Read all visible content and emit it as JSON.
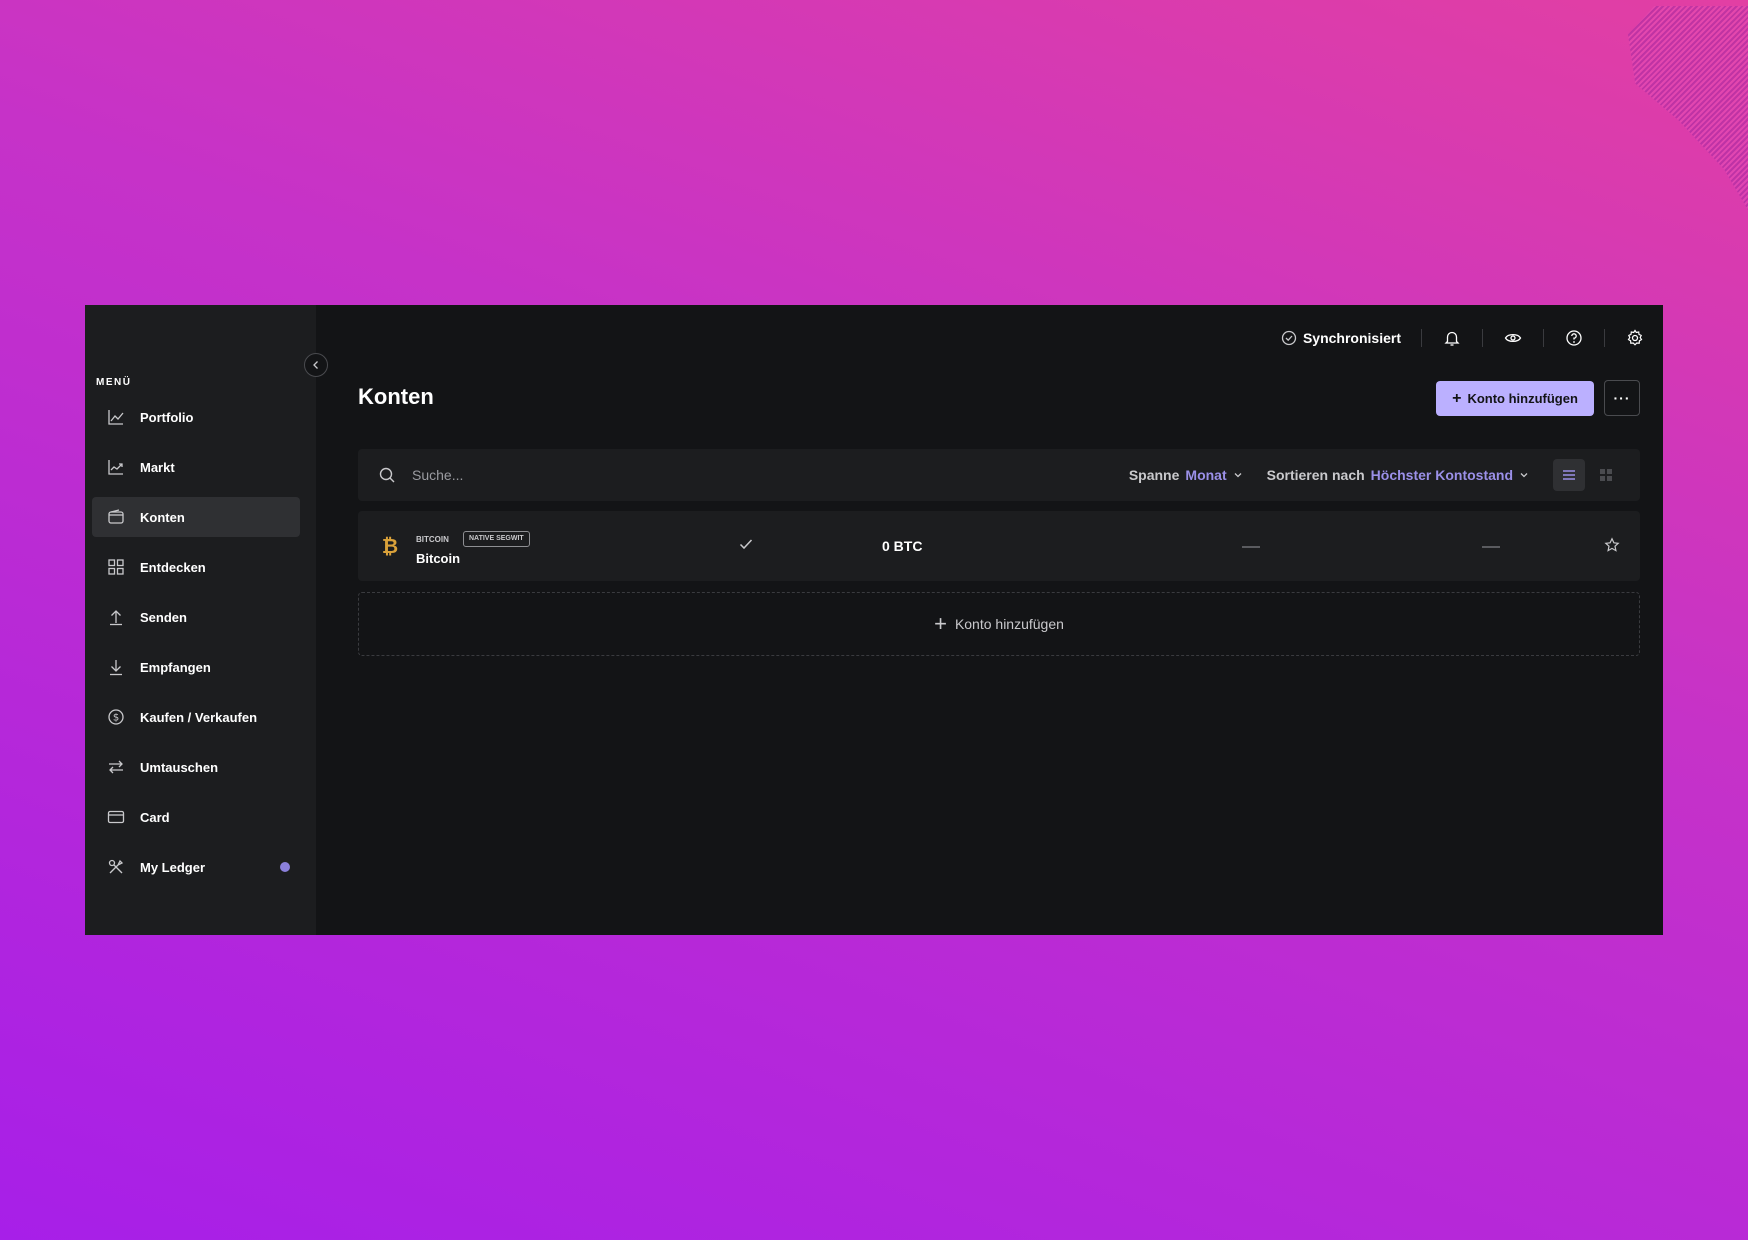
{
  "sidebar": {
    "menu_title": "MENÜ",
    "items": [
      {
        "label": "Portfolio",
        "icon": "chart-line-icon"
      },
      {
        "label": "Markt",
        "icon": "trend-icon"
      },
      {
        "label": "Konten",
        "icon": "wallet-icon",
        "active": true
      },
      {
        "label": "Entdecken",
        "icon": "grid-icon"
      },
      {
        "label": "Senden",
        "icon": "arrow-up-icon"
      },
      {
        "label": "Empfangen",
        "icon": "arrow-down-icon"
      },
      {
        "label": "Kaufen / Verkaufen",
        "icon": "dollar-icon"
      },
      {
        "label": "Umtauschen",
        "icon": "swap-icon"
      },
      {
        "label": "Card",
        "icon": "card-icon"
      },
      {
        "label": "My Ledger",
        "icon": "tools-icon",
        "badge_dot": true
      }
    ]
  },
  "topbar": {
    "sync_status": "Synchronisiert"
  },
  "page": {
    "title": "Konten",
    "add_account_label": "Konto hinzufügen",
    "more_label": "···"
  },
  "toolbar": {
    "search_placeholder": "Suche...",
    "range_label": "Spanne",
    "range_value": "Monat",
    "sort_label": "Sortieren nach",
    "sort_value": "Höchster Kontostand"
  },
  "accounts": [
    {
      "ticker": "BITCOIN",
      "tag": "NATIVE SEGWIT",
      "name": "Bitcoin",
      "balance": "0 BTC"
    }
  ],
  "add_row": {
    "label": "Konto hinzufügen"
  },
  "colors": {
    "accent": "#bbb0ff",
    "accent_text": "#9b90e8",
    "bitcoin": "#d9a13a",
    "app_bg": "#131416",
    "panel_bg": "#1c1d1f"
  }
}
